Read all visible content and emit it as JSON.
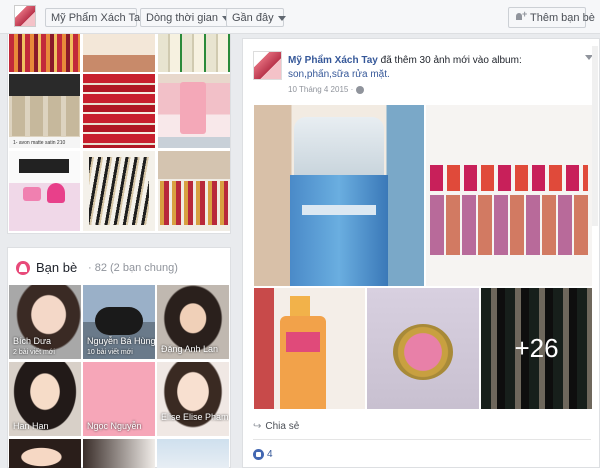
{
  "topbar": {
    "filters": [
      {
        "label": "Mỹ Phẩm Xách Tay"
      },
      {
        "label": "Dòng thời gian"
      },
      {
        "label": "Gần đây"
      }
    ],
    "add_friend_label": "Thêm bạn bè"
  },
  "left_photos": {
    "caption": "1- avon matte satin 210"
  },
  "friends": {
    "title": "Bạn bè",
    "count": "· 82 (2 bạn chung)",
    "items": [
      {
        "name": "Bích Dưa",
        "sub": "2 bài viết mới"
      },
      {
        "name": "Nguyễn Bá Hùng",
        "sub": "10 bài viết mới"
      },
      {
        "name": "Đặng Anh Lan",
        "sub": ""
      },
      {
        "name": "Han Han",
        "sub": ""
      },
      {
        "name": "Ngọc Nguyễn",
        "sub": ""
      },
      {
        "name": "Elise Elise Pham",
        "sub": ""
      }
    ]
  },
  "post": {
    "author": "Mỹ Phẩm Xách Tay",
    "action": " đã thêm 30 ảnh mới vào album: ",
    "album": "son,phấn,sữa rửa mặt.",
    "date": "10 Tháng 4 2015 ·",
    "more_count": "+26",
    "share_label": "Chia sẻ",
    "like_count": "4"
  },
  "colors": {
    "link": "#365899",
    "background": "#e9ebee",
    "brand_pink": "#e84a7a"
  }
}
